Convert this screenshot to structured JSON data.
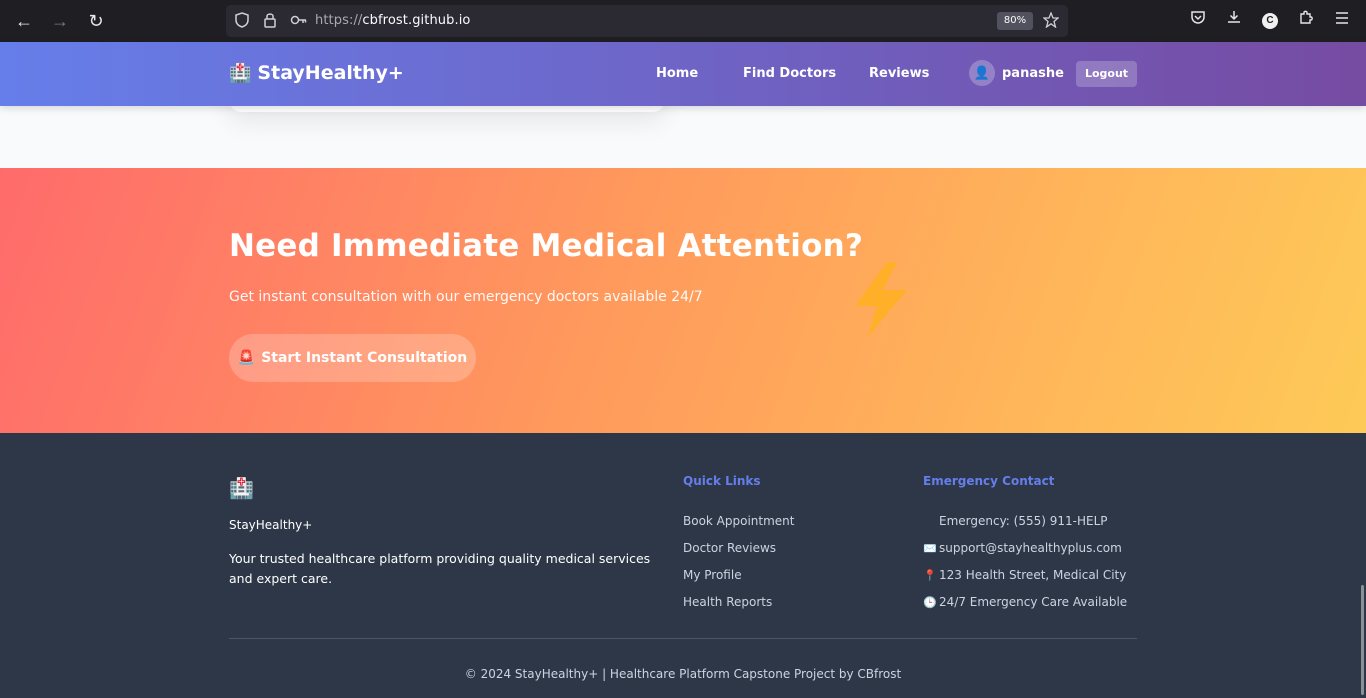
{
  "browser": {
    "url_scheme": "https://",
    "url_host": "cbfrost.github.io",
    "zoom": "80%",
    "profile_initial": "C"
  },
  "header": {
    "brand": "StayHealthy+",
    "nav": [
      "Home",
      "Find Doctors",
      "Reviews"
    ],
    "user_name": "panashe",
    "logout_label": "Logout"
  },
  "banner": {
    "title": "Need Immediate Medical Attention?",
    "subtitle": "Get instant consultation with our emergency doctors available 24/7",
    "button_label": "Start Instant Consultation"
  },
  "footer": {
    "brand": "StayHealthy+",
    "description": "Your trusted healthcare platform providing quality medical services and expert care.",
    "quick_links_title": "Quick Links",
    "quick_links": [
      "Book Appointment",
      "Doctor Reviews",
      "My Profile",
      "Health Reports"
    ],
    "emergency_title": "Emergency Contact",
    "contacts": [
      {
        "icon": "phone-icon",
        "text": "Emergency: (555) 911-HELP"
      },
      {
        "icon": "email-icon",
        "text": "support@stayhealthyplus.com"
      },
      {
        "icon": "location-pin-icon",
        "text": "123 Health Street, Medical City"
      },
      {
        "icon": "clock-icon",
        "text": "24/7 Emergency Care Available"
      }
    ],
    "copyright": "© 2024 StayHealthy+ | Healthcare Platform Capstone Project by CBfrost"
  },
  "colors": {
    "header_gradient_start": "#667eea",
    "header_gradient_end": "#764ba2",
    "banner_gradient_start": "#ff6b6b",
    "banner_gradient_end": "#feca57",
    "footer_bg": "#2d3748",
    "footer_heading": "#667eea"
  }
}
